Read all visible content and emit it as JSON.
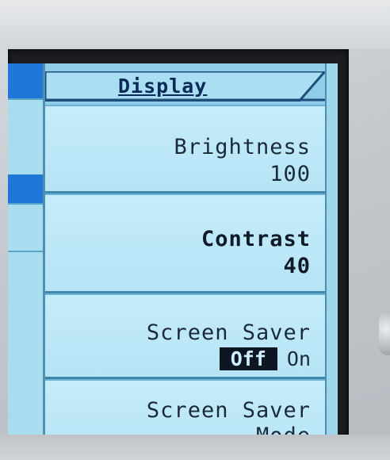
{
  "menu": {
    "title": "Display",
    "softkeys": [
      {
        "label": "Brightness",
        "value": "100",
        "selected": false
      },
      {
        "label": "Contrast",
        "value": "40",
        "selected": true
      },
      {
        "label": "Screen Saver",
        "options": [
          "Off",
          "On"
        ],
        "active_option": "Off"
      },
      {
        "label_line1": "Screen Saver",
        "label_line2": "Mode"
      }
    ]
  },
  "colors": {
    "lcd_background": "#8fcde8",
    "highlight_blue": "#1f78d8",
    "text_dark": "#0c2a57"
  }
}
